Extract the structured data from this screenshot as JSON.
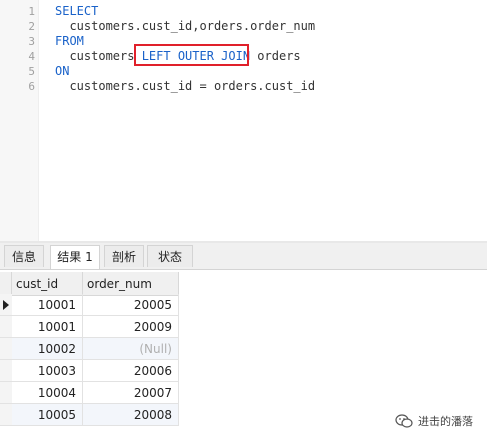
{
  "editor": {
    "lines": [
      {
        "num": "1",
        "text": "SELECT"
      },
      {
        "num": "2",
        "text": "  customers.cust_id,orders.order_num"
      },
      {
        "num": "3",
        "text": "FROM"
      },
      {
        "num": "4",
        "pre": "  customers ",
        "kw": "LEFT OUTER JOIN",
        "post": " orders"
      },
      {
        "num": "5",
        "text": "ON"
      },
      {
        "num": "6",
        "text": "  customers.cust_id = orders.cust_id"
      }
    ]
  },
  "tabs": [
    "信息",
    "结果 1",
    "剖析",
    "状态"
  ],
  "active_tab": "结果 1",
  "grid": {
    "columns": [
      "cust_id",
      "order_num"
    ],
    "rows": [
      {
        "cust_id": "10001",
        "order_num": "20005"
      },
      {
        "cust_id": "10001",
        "order_num": "20009"
      },
      {
        "cust_id": "10002",
        "order_num": "(Null)"
      },
      {
        "cust_id": "10003",
        "order_num": "20006"
      },
      {
        "cust_id": "10004",
        "order_num": "20007"
      },
      {
        "cust_id": "10005",
        "order_num": "20008"
      }
    ]
  },
  "watermark": "进击的潘落",
  "colors": {
    "keyword": "#1a62c9",
    "highlight_box": "#e0202a",
    "null_text": "#b0b0b0"
  }
}
